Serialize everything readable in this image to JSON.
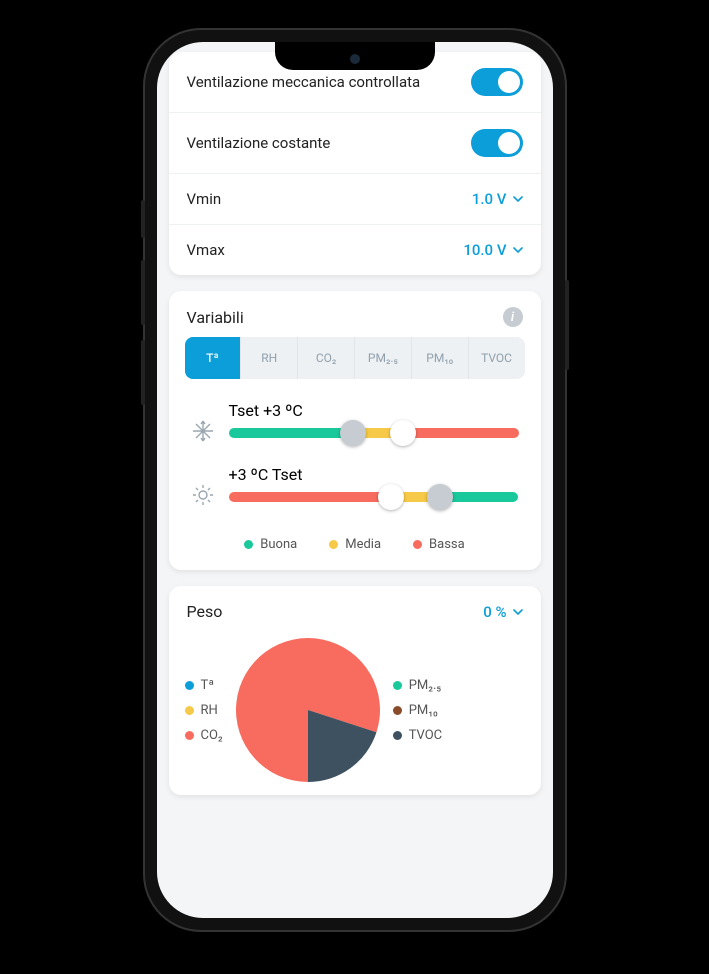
{
  "settings": {
    "vmc_label": "Ventilazione meccanica controllata",
    "vmc_on": true,
    "vconst_label": "Ventilazione costante",
    "vconst_on": true,
    "vmin_label": "Vmin",
    "vmin_value": "1.0 V",
    "vmax_label": "Vmax",
    "vmax_value": "10.0 V"
  },
  "variables": {
    "title": "Variabili",
    "tabs": [
      "Tª",
      "RH",
      "CO₂",
      "PM₂.₅",
      "PM₁₀",
      "TVOC"
    ],
    "active_tab": "Tª",
    "slider_cool": {
      "handle1_label": "Tset",
      "handle2_label": "+3 ºC"
    },
    "slider_heat": {
      "handle1_label": "+3 ºC",
      "handle2_label": "Tset"
    },
    "legend": {
      "good": "Buona",
      "mid": "Media",
      "low": "Bassa"
    }
  },
  "peso": {
    "title": "Peso",
    "value": "0 %",
    "legend_left": [
      "Tª",
      "RH",
      "CO₂"
    ],
    "legend_right": [
      "PM₂.₅",
      "PM₁₀",
      "TVOC"
    ]
  },
  "chart_data": {
    "type": "pie",
    "title": "Peso",
    "series": [
      {
        "name": "Tª",
        "value": 0,
        "color": "#0b9ed9"
      },
      {
        "name": "RH",
        "value": 0,
        "color": "#f7c948"
      },
      {
        "name": "CO₂",
        "value": 80,
        "color": "#f76c5e"
      },
      {
        "name": "PM₂.₅",
        "value": 0,
        "color": "#19c89b"
      },
      {
        "name": "PM₁₀",
        "value": 0,
        "color": "#8a4b2a"
      },
      {
        "name": "TVOC",
        "value": 20,
        "color": "#3e5161"
      }
    ]
  }
}
